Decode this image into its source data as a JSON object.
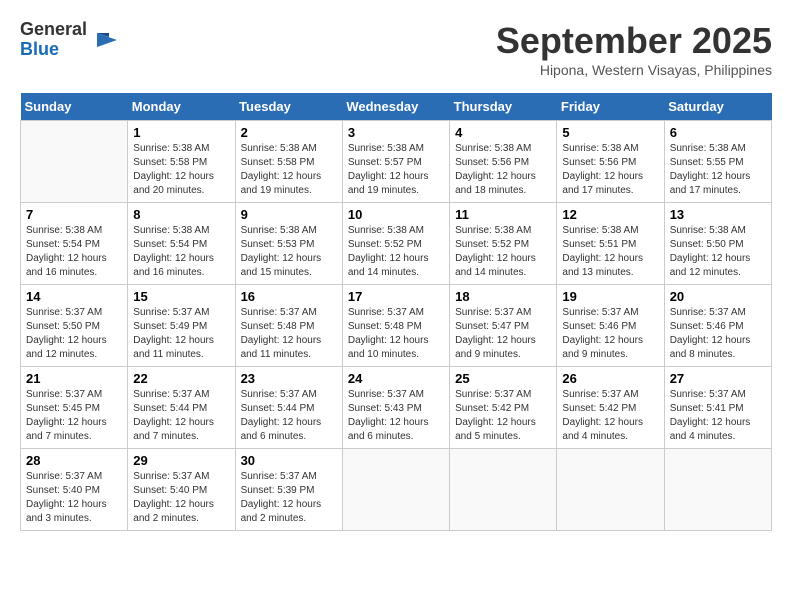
{
  "header": {
    "logo_line1": "General",
    "logo_line2": "Blue",
    "month": "September 2025",
    "location": "Hipona, Western Visayas, Philippines"
  },
  "days_of_week": [
    "Sunday",
    "Monday",
    "Tuesday",
    "Wednesday",
    "Thursday",
    "Friday",
    "Saturday"
  ],
  "weeks": [
    [
      {
        "day": "",
        "info": ""
      },
      {
        "day": "1",
        "info": "Sunrise: 5:38 AM\nSunset: 5:58 PM\nDaylight: 12 hours\nand 20 minutes."
      },
      {
        "day": "2",
        "info": "Sunrise: 5:38 AM\nSunset: 5:58 PM\nDaylight: 12 hours\nand 19 minutes."
      },
      {
        "day": "3",
        "info": "Sunrise: 5:38 AM\nSunset: 5:57 PM\nDaylight: 12 hours\nand 19 minutes."
      },
      {
        "day": "4",
        "info": "Sunrise: 5:38 AM\nSunset: 5:56 PM\nDaylight: 12 hours\nand 18 minutes."
      },
      {
        "day": "5",
        "info": "Sunrise: 5:38 AM\nSunset: 5:56 PM\nDaylight: 12 hours\nand 17 minutes."
      },
      {
        "day": "6",
        "info": "Sunrise: 5:38 AM\nSunset: 5:55 PM\nDaylight: 12 hours\nand 17 minutes."
      }
    ],
    [
      {
        "day": "7",
        "info": "Sunrise: 5:38 AM\nSunset: 5:54 PM\nDaylight: 12 hours\nand 16 minutes."
      },
      {
        "day": "8",
        "info": "Sunrise: 5:38 AM\nSunset: 5:54 PM\nDaylight: 12 hours\nand 16 minutes."
      },
      {
        "day": "9",
        "info": "Sunrise: 5:38 AM\nSunset: 5:53 PM\nDaylight: 12 hours\nand 15 minutes."
      },
      {
        "day": "10",
        "info": "Sunrise: 5:38 AM\nSunset: 5:52 PM\nDaylight: 12 hours\nand 14 minutes."
      },
      {
        "day": "11",
        "info": "Sunrise: 5:38 AM\nSunset: 5:52 PM\nDaylight: 12 hours\nand 14 minutes."
      },
      {
        "day": "12",
        "info": "Sunrise: 5:38 AM\nSunset: 5:51 PM\nDaylight: 12 hours\nand 13 minutes."
      },
      {
        "day": "13",
        "info": "Sunrise: 5:38 AM\nSunset: 5:50 PM\nDaylight: 12 hours\nand 12 minutes."
      }
    ],
    [
      {
        "day": "14",
        "info": "Sunrise: 5:37 AM\nSunset: 5:50 PM\nDaylight: 12 hours\nand 12 minutes."
      },
      {
        "day": "15",
        "info": "Sunrise: 5:37 AM\nSunset: 5:49 PM\nDaylight: 12 hours\nand 11 minutes."
      },
      {
        "day": "16",
        "info": "Sunrise: 5:37 AM\nSunset: 5:48 PM\nDaylight: 12 hours\nand 11 minutes."
      },
      {
        "day": "17",
        "info": "Sunrise: 5:37 AM\nSunset: 5:48 PM\nDaylight: 12 hours\nand 10 minutes."
      },
      {
        "day": "18",
        "info": "Sunrise: 5:37 AM\nSunset: 5:47 PM\nDaylight: 12 hours\nand 9 minutes."
      },
      {
        "day": "19",
        "info": "Sunrise: 5:37 AM\nSunset: 5:46 PM\nDaylight: 12 hours\nand 9 minutes."
      },
      {
        "day": "20",
        "info": "Sunrise: 5:37 AM\nSunset: 5:46 PM\nDaylight: 12 hours\nand 8 minutes."
      }
    ],
    [
      {
        "day": "21",
        "info": "Sunrise: 5:37 AM\nSunset: 5:45 PM\nDaylight: 12 hours\nand 7 minutes."
      },
      {
        "day": "22",
        "info": "Sunrise: 5:37 AM\nSunset: 5:44 PM\nDaylight: 12 hours\nand 7 minutes."
      },
      {
        "day": "23",
        "info": "Sunrise: 5:37 AM\nSunset: 5:44 PM\nDaylight: 12 hours\nand 6 minutes."
      },
      {
        "day": "24",
        "info": "Sunrise: 5:37 AM\nSunset: 5:43 PM\nDaylight: 12 hours\nand 6 minutes."
      },
      {
        "day": "25",
        "info": "Sunrise: 5:37 AM\nSunset: 5:42 PM\nDaylight: 12 hours\nand 5 minutes."
      },
      {
        "day": "26",
        "info": "Sunrise: 5:37 AM\nSunset: 5:42 PM\nDaylight: 12 hours\nand 4 minutes."
      },
      {
        "day": "27",
        "info": "Sunrise: 5:37 AM\nSunset: 5:41 PM\nDaylight: 12 hours\nand 4 minutes."
      }
    ],
    [
      {
        "day": "28",
        "info": "Sunrise: 5:37 AM\nSunset: 5:40 PM\nDaylight: 12 hours\nand 3 minutes."
      },
      {
        "day": "29",
        "info": "Sunrise: 5:37 AM\nSunset: 5:40 PM\nDaylight: 12 hours\nand 2 minutes."
      },
      {
        "day": "30",
        "info": "Sunrise: 5:37 AM\nSunset: 5:39 PM\nDaylight: 12 hours\nand 2 minutes."
      },
      {
        "day": "",
        "info": ""
      },
      {
        "day": "",
        "info": ""
      },
      {
        "day": "",
        "info": ""
      },
      {
        "day": "",
        "info": ""
      }
    ]
  ]
}
